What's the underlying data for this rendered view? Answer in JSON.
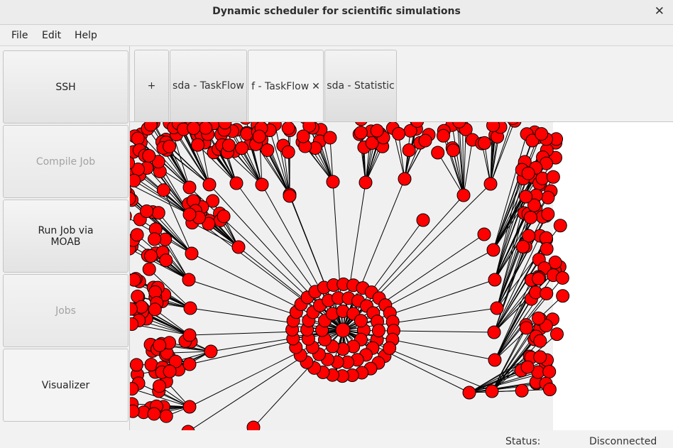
{
  "window": {
    "title": "Dynamic scheduler for scientific simulations",
    "close_glyph": "✕"
  },
  "menu": {
    "items": [
      "File",
      "Edit",
      "Help"
    ]
  },
  "sidebar": {
    "buttons": [
      {
        "label": "SSH",
        "state": "enabled"
      },
      {
        "label": "Compile Job",
        "state": "disabled"
      },
      {
        "label": "Run Job via\nMOAB",
        "state": "enabled"
      },
      {
        "label": "Jobs",
        "state": "disabled"
      },
      {
        "label": "Visualizer",
        "state": "selected"
      }
    ]
  },
  "tabs": {
    "items": [
      {
        "label": "+"
      },
      {
        "label": "sda - TaskFlow"
      },
      {
        "label": "f - TaskFlow",
        "close": "✕",
        "active": true
      },
      {
        "label": "sda - Statistic"
      }
    ]
  },
  "graph": {
    "node_color": "#ff0000",
    "edge_color": "#000000",
    "background": "#f0f0f0"
  },
  "status": {
    "label": "Status:",
    "value": "Disconnected"
  }
}
